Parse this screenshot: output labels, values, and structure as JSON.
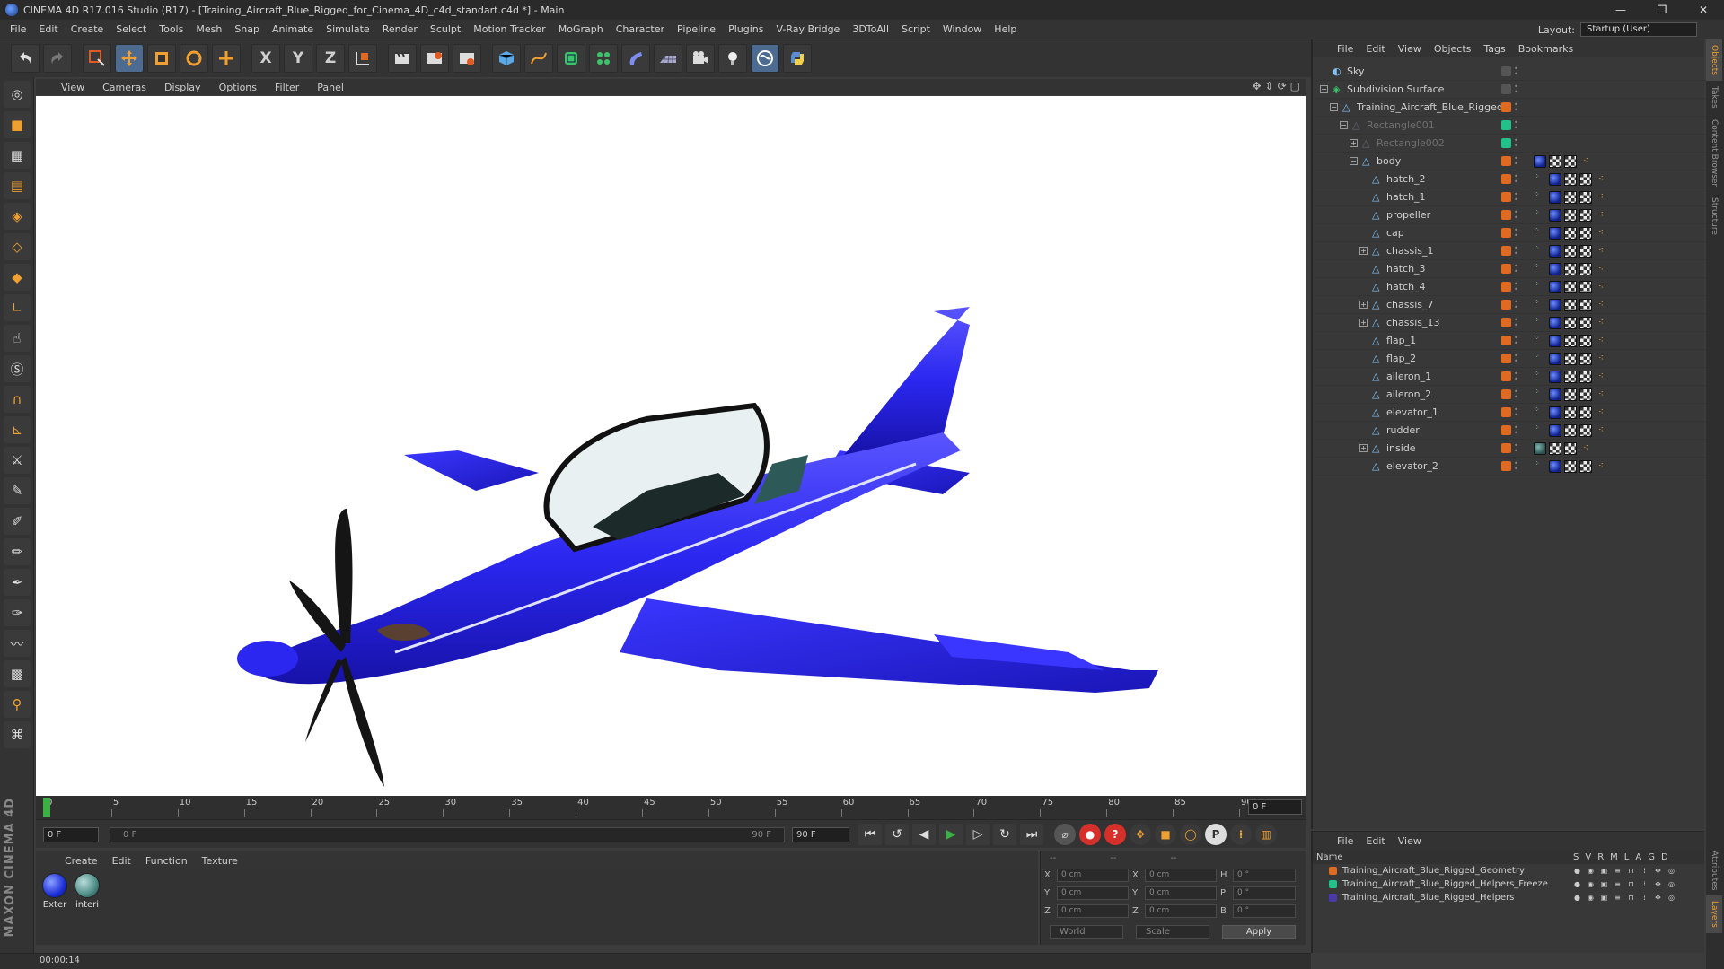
{
  "window": {
    "title": "CINEMA 4D R17.016 Studio (R17) - [Training_Aircraft_Blue_Rigged_for_Cinema_4D_c4d_standart.c4d *] - Main",
    "minimize": "—",
    "maximize": "❐",
    "close": "✕"
  },
  "menubar": {
    "items": [
      "File",
      "Edit",
      "Create",
      "Select",
      "Tools",
      "Mesh",
      "Snap",
      "Animate",
      "Simulate",
      "Render",
      "Sculpt",
      "Motion Tracker",
      "MoGraph",
      "Character",
      "Pipeline",
      "Plugins",
      "V-Ray Bridge",
      "3DToAll",
      "Script",
      "Window",
      "Help"
    ],
    "layout_label": "Layout:",
    "layout_value": "Startup (User)"
  },
  "toolbar": {
    "axis_x": "X",
    "axis_y": "Y",
    "axis_z": "Z"
  },
  "viewport": {
    "menu": [
      "View",
      "Cameras",
      "Display",
      "Options",
      "Filter",
      "Panel"
    ],
    "model_color": "#2b27f0",
    "background_color": "#ffffff"
  },
  "timeline": {
    "ticks": [
      "0",
      "5",
      "10",
      "15",
      "20",
      "25",
      "30",
      "35",
      "40",
      "45",
      "50",
      "55",
      "60",
      "65",
      "70",
      "75",
      "80",
      "85",
      "90"
    ],
    "current_frame": "0 F",
    "playhead_frame": 0
  },
  "transport": {
    "start_field": "0 F",
    "slider_start": "0 F",
    "slider_end": "90 F",
    "end_field": "90 F"
  },
  "materials": {
    "menu": [
      "Create",
      "Edit",
      "Function",
      "Texture"
    ],
    "items": [
      {
        "label": "Exter",
        "color": "#1d2fd8"
      },
      {
        "label": "interi",
        "color": "#4d8c86"
      }
    ]
  },
  "coordinates": {
    "header_left": "--",
    "header_mid": "--",
    "header_right": "--",
    "rows": [
      {
        "a1": "X",
        "v1": "0 cm",
        "a2": "X",
        "v2": "0 cm",
        "a3": "H",
        "v3": "0 °"
      },
      {
        "a1": "Y",
        "v1": "0 cm",
        "a2": "Y",
        "v2": "0 cm",
        "a3": "P",
        "v3": "0 °"
      },
      {
        "a1": "Z",
        "v1": "0 cm",
        "a2": "Z",
        "v2": "0 cm",
        "a3": "B",
        "v3": "0 °"
      }
    ],
    "world": "World",
    "scale": "Scale",
    "apply": "Apply"
  },
  "status": {
    "time": "00:00:14"
  },
  "object_manager": {
    "menu": [
      "File",
      "Edit",
      "View",
      "Objects",
      "Tags",
      "Bookmarks"
    ],
    "objects": [
      {
        "name": "Sky",
        "depth": 0,
        "expand": "",
        "dim": false,
        "tags": "none",
        "layer": "#555555"
      },
      {
        "name": "Subdivision Surface",
        "depth": 0,
        "expand": "−",
        "dim": false,
        "tags": "none",
        "layer": "#555555"
      },
      {
        "name": "Training_Aircraft_Blue_Rigged",
        "depth": 1,
        "expand": "−",
        "dim": false,
        "tags": "none",
        "layer": "#e06a22"
      },
      {
        "name": "Rectangle001",
        "depth": 2,
        "expand": "−",
        "dim": true,
        "tags": "none",
        "layer": "#22c18a"
      },
      {
        "name": "Rectangle002",
        "depth": 3,
        "expand": "+",
        "dim": true,
        "tags": "none",
        "layer": "#22c18a"
      },
      {
        "name": "body",
        "depth": 3,
        "expand": "−",
        "dim": false,
        "tags": "short",
        "layer": "#e06a22"
      },
      {
        "name": "hatch_2",
        "depth": 4,
        "expand": "",
        "dim": false,
        "tags": "full",
        "layer": "#e06a22"
      },
      {
        "name": "hatch_1",
        "depth": 4,
        "expand": "",
        "dim": false,
        "tags": "full",
        "layer": "#e06a22"
      },
      {
        "name": "propeller",
        "depth": 4,
        "expand": "",
        "dim": false,
        "tags": "full",
        "layer": "#e06a22"
      },
      {
        "name": "cap",
        "depth": 4,
        "expand": "",
        "dim": false,
        "tags": "full",
        "layer": "#e06a22"
      },
      {
        "name": "chassis_1",
        "depth": 4,
        "expand": "+",
        "dim": false,
        "tags": "full",
        "layer": "#e06a22"
      },
      {
        "name": "hatch_3",
        "depth": 4,
        "expand": "",
        "dim": false,
        "tags": "full",
        "layer": "#e06a22"
      },
      {
        "name": "hatch_4",
        "depth": 4,
        "expand": "",
        "dim": false,
        "tags": "full",
        "layer": "#e06a22"
      },
      {
        "name": "chassis_7",
        "depth": 4,
        "expand": "+",
        "dim": false,
        "tags": "full",
        "layer": "#e06a22"
      },
      {
        "name": "chassis_13",
        "depth": 4,
        "expand": "+",
        "dim": false,
        "tags": "full",
        "layer": "#e06a22"
      },
      {
        "name": "flap_1",
        "depth": 4,
        "expand": "",
        "dim": false,
        "tags": "full",
        "layer": "#e06a22"
      },
      {
        "name": "flap_2",
        "depth": 4,
        "expand": "",
        "dim": false,
        "tags": "full",
        "layer": "#e06a22"
      },
      {
        "name": "aileron_1",
        "depth": 4,
        "expand": "",
        "dim": false,
        "tags": "full",
        "layer": "#e06a22"
      },
      {
        "name": "aileron_2",
        "depth": 4,
        "expand": "",
        "dim": false,
        "tags": "full",
        "layer": "#e06a22"
      },
      {
        "name": "elevator_1",
        "depth": 4,
        "expand": "",
        "dim": false,
        "tags": "full",
        "layer": "#e06a22"
      },
      {
        "name": "rudder",
        "depth": 4,
        "expand": "",
        "dim": false,
        "tags": "full",
        "layer": "#e06a22"
      },
      {
        "name": "inside",
        "depth": 4,
        "expand": "+",
        "dim": false,
        "tags": "inside",
        "layer": "#e06a22"
      },
      {
        "name": "elevator_2",
        "depth": 4,
        "expand": "",
        "dim": false,
        "tags": "full",
        "layer": "#e06a22"
      }
    ]
  },
  "side_tabs": [
    "Objects",
    "Takes",
    "Content Browser",
    "Structure"
  ],
  "side_tabs_bottom": [
    "Attributes",
    "Layers"
  ],
  "layer_manager": {
    "menu": [
      "File",
      "Edit",
      "View"
    ],
    "header_name": "Name",
    "columns": [
      "S",
      "V",
      "R",
      "M",
      "L",
      "A",
      "G",
      "D"
    ],
    "layers": [
      {
        "name": "Training_Aircraft_Blue_Rigged_Geometry",
        "color": "#e06a22"
      },
      {
        "name": "Training_Aircraft_Blue_Rigged_Helpers_Freeze",
        "color": "#22c18a"
      },
      {
        "name": "Training_Aircraft_Blue_Rigged_Helpers",
        "color": "#4a3aa8"
      }
    ]
  }
}
